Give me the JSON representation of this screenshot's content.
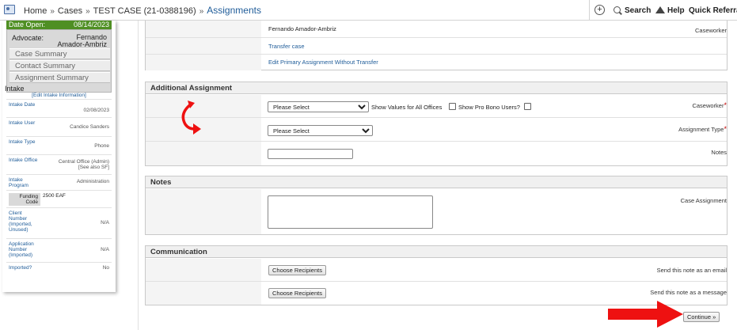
{
  "breadcrumb": {
    "home": "Home",
    "sep": "»",
    "cases": "Cases",
    "case": "TEST CASE (21-0388196)",
    "current": "Assignments"
  },
  "topnav": {
    "search": "Search",
    "help": "Help",
    "quick_referral": "Quick Referral"
  },
  "sidebar": {
    "date_open_label": "Date Open:",
    "date_open_value": "08/14/2023",
    "advocate_label": "Advocate:",
    "advocate_value": "Fernando Amador-Ambriz",
    "tabs": [
      "Case Summary",
      "Contact Summary",
      "Assignment Summary"
    ],
    "intake_title": "Intake",
    "edit_intake": "[Edit Intake Information]",
    "intake_rows": [
      {
        "key": "Intake Date",
        "value": "02/08/2023"
      },
      {
        "key": "Intake User",
        "value": "Candice Sanders"
      },
      {
        "key": "Intake Type",
        "value": "Phone"
      },
      {
        "key": "Intake Office",
        "value": "Central Office (Admin) [See also SF]"
      },
      {
        "key": "Intake Program",
        "value": "Administration"
      }
    ],
    "funding_code_label": "Funding Code",
    "funding_code_value": "2500 EAF",
    "extra_rows": [
      {
        "key": "Client Number (Imported, Unused)",
        "value": "N/A"
      },
      {
        "key": "Application Number (Imported)",
        "value": "N/A"
      },
      {
        "key": "Imported?",
        "value": "No"
      }
    ]
  },
  "primary": {
    "caseworker_label": "Caseworker",
    "caseworker_value": "Fernando Amador-Ambriz",
    "transfer_link": "Transfer case",
    "edit_primary_link": "Edit Primary Assignment Without Transfer"
  },
  "additional": {
    "title": "Additional Assignment",
    "caseworker_label": "Caseworker",
    "caseworker_select": "Please Select",
    "show_all_offices": "Show Values for All Offices",
    "show_pro_bono": "Show Pro Bono Users?",
    "assignment_type_label": "Assignment Type",
    "assignment_type_select": "Please Select",
    "notes_label": "Notes",
    "required_mark": "*"
  },
  "notes": {
    "title": "Notes",
    "case_assignment_label": "Case Assignment"
  },
  "communication": {
    "title": "Communication",
    "email_label": "Send this note as an email",
    "message_label": "Send this note as a message",
    "choose_recipients": "Choose Recipients"
  },
  "footer": {
    "continue": "Continue »"
  },
  "colors": {
    "date_open_bg": "#4f8f23",
    "link": "#1f5c99",
    "required": "#c00000",
    "arrow": "#ee1111"
  }
}
